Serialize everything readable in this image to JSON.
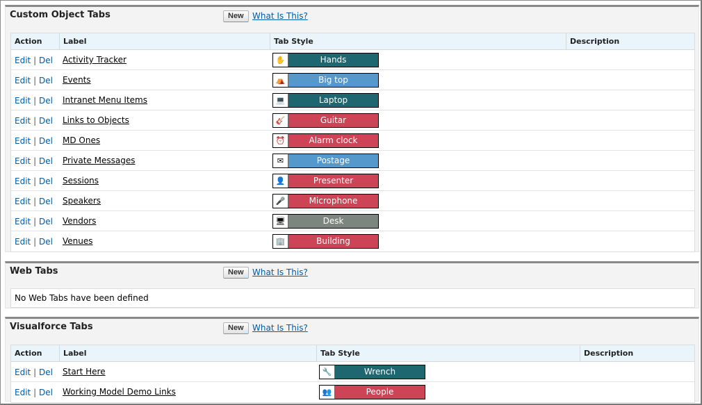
{
  "custom_object_tabs": {
    "title": "Custom Object Tabs",
    "new_label": "New",
    "help_label": "What Is This?",
    "columns": [
      "Action",
      "Label",
      "Tab Style",
      "Description"
    ],
    "edit_label": "Edit",
    "separator": "|",
    "del_label": "Del",
    "rows": [
      {
        "label": "Activity Tracker",
        "style": "Hands",
        "color": "#1e6670",
        "icon": "hands-icon",
        "glyph": "✋"
      },
      {
        "label": "Events",
        "style": "Big top",
        "color": "#5599cc",
        "icon": "big-top-icon",
        "glyph": "⛺"
      },
      {
        "label": "Intranet Menu Items",
        "style": "Laptop",
        "color": "#1e6670",
        "icon": "laptop-icon",
        "glyph": "💻"
      },
      {
        "label": "Links to Objects",
        "style": "Guitar",
        "color": "#cc4455",
        "icon": "guitar-icon",
        "glyph": "🎸"
      },
      {
        "label": "MD Ones",
        "style": "Alarm clock",
        "color": "#cc4455",
        "icon": "alarm-clock-icon",
        "glyph": "⏰"
      },
      {
        "label": "Private Messages",
        "style": "Postage",
        "color": "#5599cc",
        "icon": "postage-icon",
        "glyph": "✉"
      },
      {
        "label": "Sessions",
        "style": "Presenter",
        "color": "#cc4455",
        "icon": "presenter-icon",
        "glyph": "👤"
      },
      {
        "label": "Speakers",
        "style": "Microphone",
        "color": "#cc4455",
        "icon": "microphone-icon",
        "glyph": "🎤"
      },
      {
        "label": "Vendors",
        "style": "Desk",
        "color": "#7c8580",
        "icon": "desk-icon",
        "glyph": "🖥"
      },
      {
        "label": "Venues",
        "style": "Building",
        "color": "#cc4455",
        "icon": "building-icon",
        "glyph": "🏢"
      }
    ]
  },
  "web_tabs": {
    "title": "Web Tabs",
    "new_label": "New",
    "help_label": "What Is This?",
    "empty_message": "No Web Tabs have been defined"
  },
  "visualforce_tabs": {
    "title": "Visualforce Tabs",
    "new_label": "New",
    "help_label": "What Is This?",
    "columns": [
      "Action",
      "Label",
      "Tab Style",
      "Description"
    ],
    "edit_label": "Edit",
    "separator": "|",
    "del_label": "Del",
    "rows": [
      {
        "label": "Start Here",
        "style": "Wrench",
        "color": "#1e6670",
        "icon": "wrench-icon",
        "glyph": "🔧"
      },
      {
        "label": "Working Model Demo Links",
        "style": "People",
        "color": "#cc4455",
        "icon": "people-icon",
        "glyph": "👥"
      }
    ]
  }
}
